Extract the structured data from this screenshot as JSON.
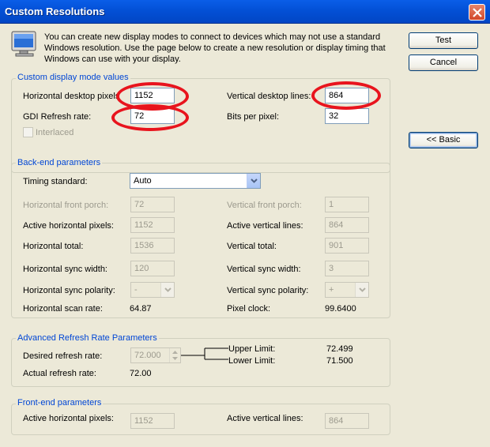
{
  "window": {
    "title": "Custom Resolutions"
  },
  "intro": {
    "text": "You can create new display modes to connect to devices which may not use a standard Windows resolution. Use the page below to create a new resolution or display timing that Windows can use with your display."
  },
  "buttons": {
    "test": "Test",
    "cancel": "Cancel",
    "basic": "<< Basic"
  },
  "custom_mode": {
    "title": "Custom display mode values",
    "h_pixels_label": "Horizontal desktop pixels",
    "h_pixels_value": "1152",
    "v_lines_label": "Vertical desktop lines:",
    "v_lines_value": "864",
    "refresh_label": "GDI Refresh rate:",
    "refresh_value": "72",
    "bpp_label": "Bits per pixel:",
    "bpp_value": "32",
    "interlaced_label": "Interlaced"
  },
  "backend": {
    "title": "Back-end parameters",
    "timing_label": "Timing standard:",
    "timing_value": "Auto",
    "h_front_porch_label": "Horizontal front porch:",
    "h_front_porch_value": "72",
    "v_front_porch_label": "Vertical front porch:",
    "v_front_porch_value": "1",
    "active_h_label": "Active horizontal pixels:",
    "active_h_value": "1152",
    "active_v_label": "Active vertical lines:",
    "active_v_value": "864",
    "h_total_label": "Horizontal total:",
    "h_total_value": "1536",
    "v_total_label": "Vertical total:",
    "v_total_value": "901",
    "h_sync_width_label": "Horizontal sync width:",
    "h_sync_width_value": "120",
    "v_sync_width_label": "Vertical sync width:",
    "v_sync_width_value": "3",
    "h_sync_pol_label": "Horizontal sync polarity:",
    "h_sync_pol_value": "-",
    "v_sync_pol_label": "Vertical sync polarity:",
    "v_sync_pol_value": "+",
    "h_scan_label": "Horizontal scan rate:",
    "h_scan_value": "64.87",
    "pixel_clock_label": "Pixel clock:",
    "pixel_clock_value": "99.6400"
  },
  "advanced": {
    "title": "Advanced Refresh Rate Parameters",
    "desired_label": "Desired refresh rate:",
    "desired_value": "72.000",
    "upper_label": "Upper Limit:",
    "upper_value": "72.499",
    "lower_label": "Lower Limit:",
    "lower_value": "71.500",
    "actual_label": "Actual refresh rate:",
    "actual_value": "72.00"
  },
  "frontend": {
    "title": "Front-end parameters",
    "active_h_label": "Active horizontal pixels:",
    "active_h_value": "1152",
    "active_v_label": "Active vertical lines:",
    "active_v_value": "864"
  },
  "colors": {
    "title_bar": "#0350d6",
    "group_title": "#0046d5",
    "annotation": "#e8141d",
    "dialog_bg": "#ece9d8"
  },
  "icons": {
    "close": "close-icon",
    "monitor": "monitor-icon",
    "dropdown": "chevron-down-icon"
  }
}
